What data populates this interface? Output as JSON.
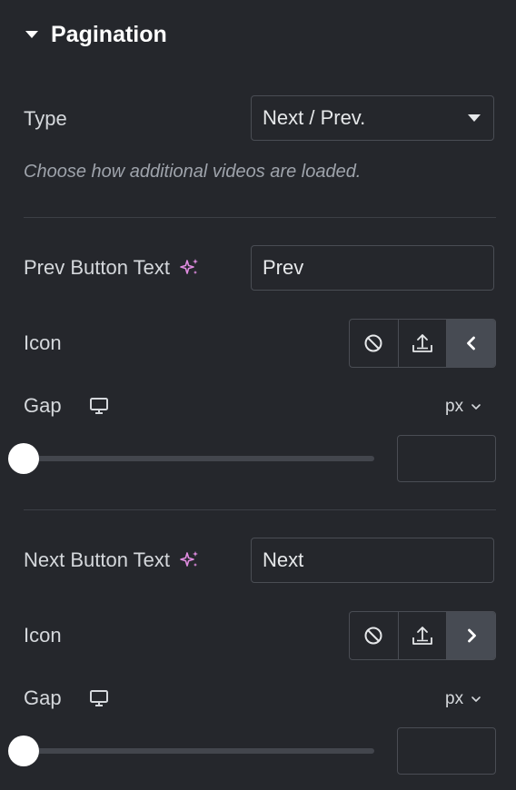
{
  "section": {
    "title": "Pagination"
  },
  "type_control": {
    "label": "Type",
    "value": "Next / Prev.",
    "help": "Choose how additional videos are loaded."
  },
  "prev": {
    "button_text_label": "Prev Button Text",
    "button_text_value": "Prev",
    "icon_label": "Icon",
    "icon_options": [
      "none-icon",
      "upload-icon",
      "chevron-left-icon"
    ],
    "icon_selected": "chevron-left-icon",
    "gap_label": "Gap",
    "gap_unit": "px",
    "gap_value": "",
    "gap_slider_level": 0
  },
  "next": {
    "button_text_label": "Next Button Text",
    "button_text_value": "Next",
    "icon_label": "Icon",
    "icon_options": [
      "none-icon",
      "upload-icon",
      "chevron-right-icon"
    ],
    "icon_selected": "chevron-right-icon",
    "gap_label": "Gap",
    "gap_unit": "px",
    "gap_value": "",
    "gap_slider_level": 0
  },
  "colors": {
    "background": "#25272c",
    "border": "#4a4d54",
    "active_button": "#474b53",
    "ai_sparkle": "#e08ce0",
    "text": "#d5d8dc",
    "help_text": "#9ea3ab"
  }
}
